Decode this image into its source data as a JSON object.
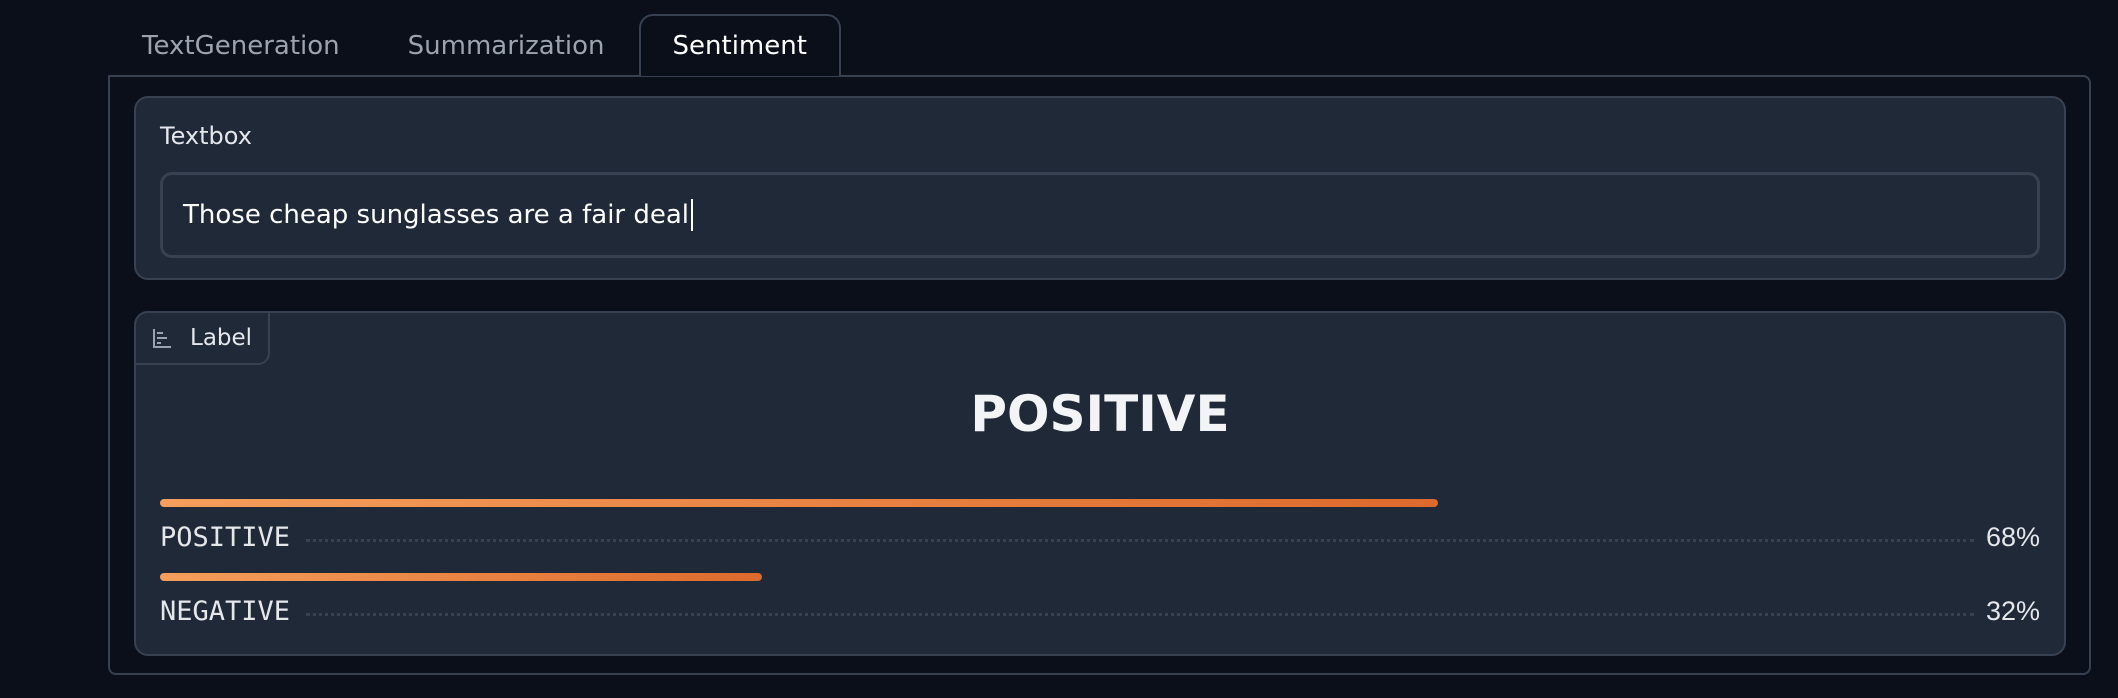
{
  "tabs": [
    {
      "label": "TextGeneration",
      "active": false
    },
    {
      "label": "Summarization",
      "active": false
    },
    {
      "label": "Sentiment",
      "active": true
    }
  ],
  "textbox": {
    "label": "Textbox",
    "value": "Those cheap sunglasses are a fair deal"
  },
  "label_output": {
    "tag": "Label",
    "tag_icon": "bar-chart-icon",
    "predicted": "POSITIVE",
    "confidences": [
      {
        "label": "POSITIVE",
        "percent_text": "68%",
        "value": 0.68
      },
      {
        "label": "NEGATIVE",
        "percent_text": "32%",
        "value": 0.32
      }
    ]
  },
  "colors": {
    "background": "#0b0f19",
    "block": "#1f2937",
    "border": "#374151",
    "bar_start": "#f59e5b",
    "bar_end": "#dd6a2c"
  }
}
